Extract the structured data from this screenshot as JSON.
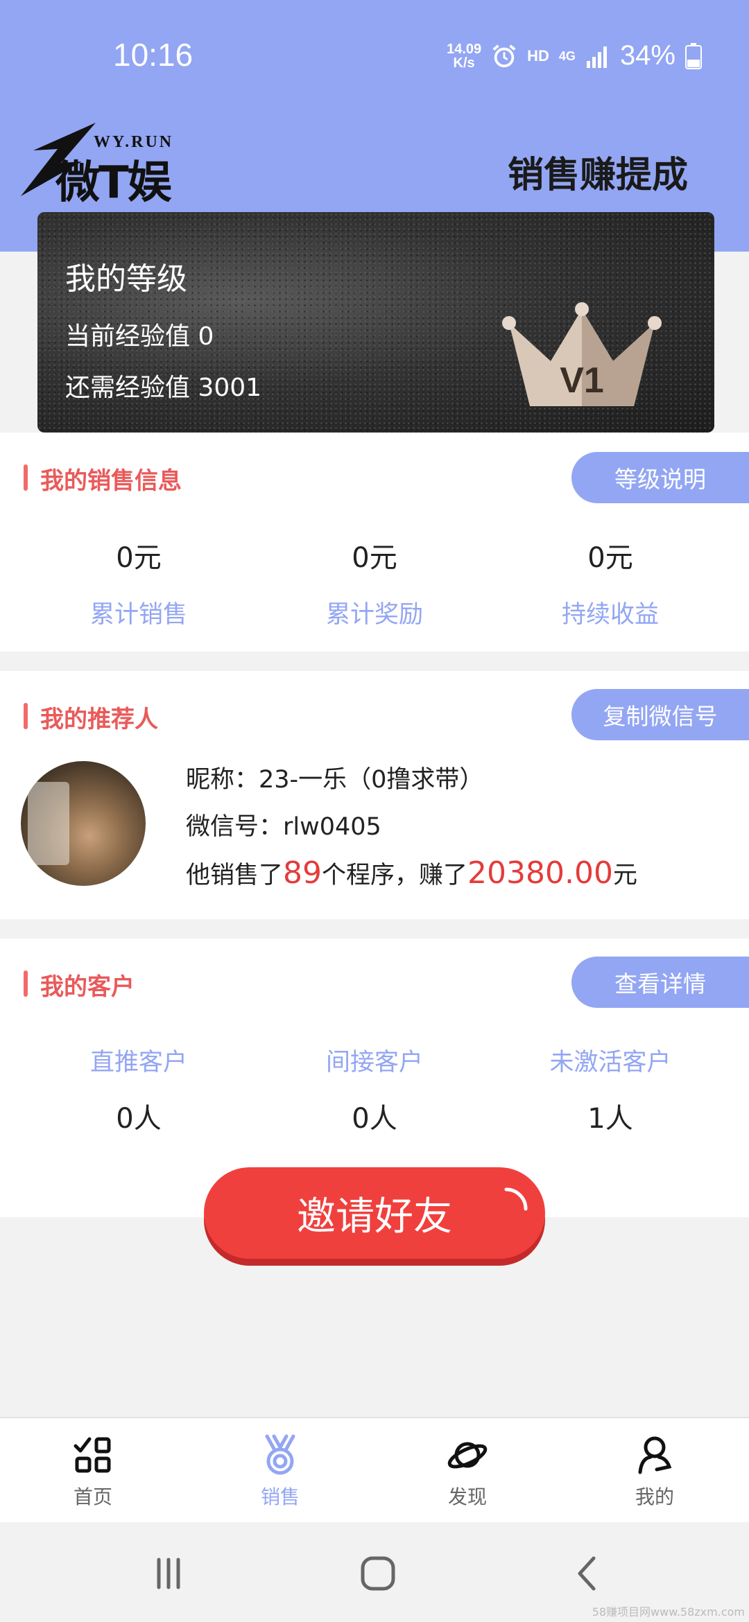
{
  "status_bar": {
    "time": "10:16",
    "net_speed_value": "14.09",
    "net_speed_unit": "K/s",
    "hd": "HD",
    "network": "4G",
    "battery": "34%"
  },
  "header": {
    "logo_sub": "WY.RUN",
    "logo_text": "微T娱",
    "title": "销售赚提成"
  },
  "level_card": {
    "title": "我的等级",
    "current_exp": "当前经验值 0",
    "needed_exp": "还需经验值 3001",
    "badge": "V1"
  },
  "sales": {
    "title": "我的销售信息",
    "button": "等级说明",
    "stats": [
      {
        "value": "0元",
        "label": "累计销售"
      },
      {
        "value": "0元",
        "label": "累计奖励"
      },
      {
        "value": "0元",
        "label": "持续收益"
      }
    ]
  },
  "referrer": {
    "title": "我的推荐人",
    "button": "复制微信号",
    "nickname": "昵称：23-一乐（0撸求带）",
    "wechat": "微信号：rlw0405",
    "sold_prefix": "他销售了",
    "sold_count": "89",
    "sold_mid": "个程序，赚了",
    "earned": "20380.00",
    "earned_suffix": "元"
  },
  "customers": {
    "title": "我的客户",
    "button": "查看详情",
    "stats": [
      {
        "label": "直推客户",
        "value": "0人"
      },
      {
        "label": "间接客户",
        "value": "0人"
      },
      {
        "label": "未激活客户",
        "value": "1人"
      }
    ]
  },
  "invite_button": "邀请好友",
  "tabbar": [
    {
      "label": "首页",
      "icon": "grid-check-icon",
      "active": false
    },
    {
      "label": "销售",
      "icon": "medal-icon",
      "active": true
    },
    {
      "label": "发现",
      "icon": "planet-icon",
      "active": false
    },
    {
      "label": "我的",
      "icon": "user-icon",
      "active": false
    }
  ],
  "watermark": "58赚项目网www.58zxm.com",
  "colors": {
    "accent": "#93a6f3",
    "title_red": "#e95a5a",
    "highlight_red": "#e53b3b",
    "invite_red": "#f0403e"
  }
}
